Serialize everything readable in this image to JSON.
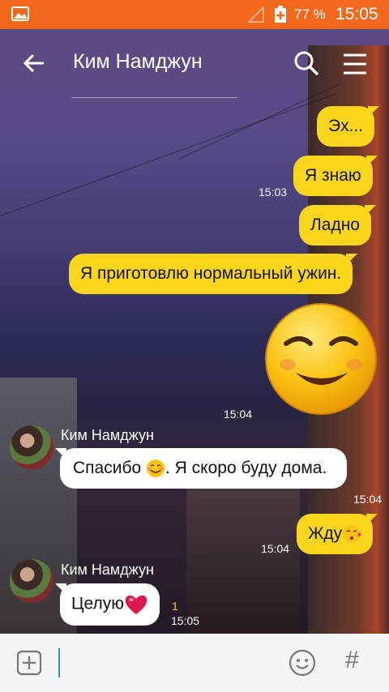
{
  "status_bar": {
    "battery": "77 %",
    "time": "15:05"
  },
  "header": {
    "contact_name": "Ким Намджун"
  },
  "messages": {
    "m1": "Эх...",
    "m2": "Я знаю",
    "t1": "15:03",
    "m3": "Ладно",
    "m4": "Я приготовлю нормальный ужин.",
    "t2": "15:04",
    "sender": "Ким Намджун",
    "in1_a": "Спасибо ",
    "in1_b": ". Я скоро буду дома.",
    "t3": "15:04",
    "m5": "Жду",
    "t4": "15:04",
    "sender2": "Ким Намджун",
    "in2": "Целую",
    "unread": "1",
    "t5": "15:05"
  },
  "input": {
    "hash_label": "#"
  },
  "colors": {
    "status_bar": "#f2691e",
    "outgoing_bubble": "#f9d61b",
    "incoming_bubble": "#ffffff",
    "cursor": "#2c9aa8"
  },
  "icons": [
    "gallery-icon",
    "signal-icon",
    "battery-icon",
    "back-arrow-icon",
    "search-icon",
    "menu-icon",
    "sticker-relieved-face",
    "blush-emoji",
    "kiss-emoji",
    "heart-emoji",
    "add-icon",
    "smile-icon"
  ]
}
